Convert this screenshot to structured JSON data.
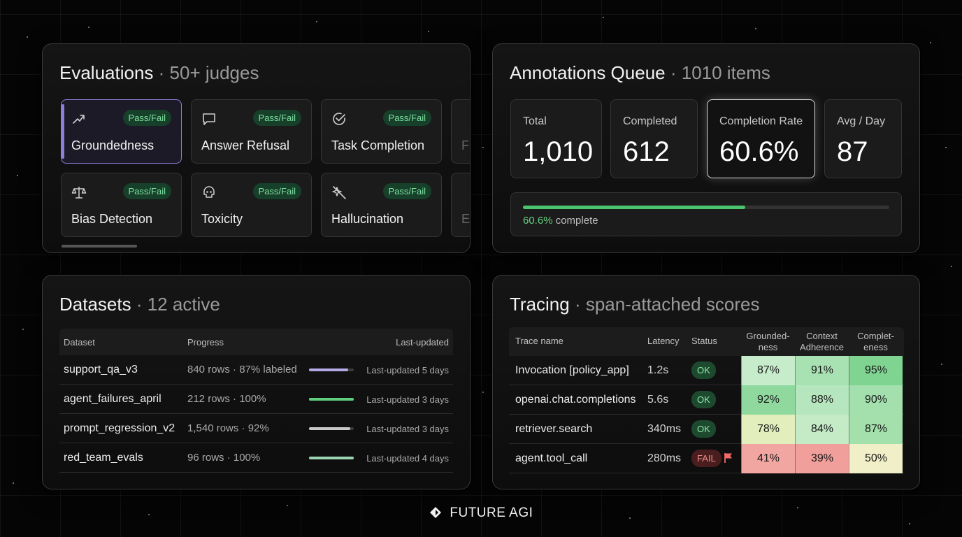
{
  "evaluations": {
    "title": "Evaluations",
    "subtitle": "· 50+ judges",
    "badge_label": "Pass/Fail",
    "judges": [
      {
        "name": "Groundedness",
        "icon": "trend-arrow-icon"
      },
      {
        "name": "Answer Refusal",
        "icon": "chat-bubble-icon"
      },
      {
        "name": "Task Completion",
        "icon": "check-circle-icon"
      },
      {
        "name": "Bias Detection",
        "icon": "scales-icon"
      },
      {
        "name": "Toxicity",
        "icon": "skull-icon"
      },
      {
        "name": "Hallucination",
        "icon": "sparkle-slash-icon"
      }
    ],
    "cut_off_letters": [
      "F",
      "E"
    ]
  },
  "annotations": {
    "title": "Annotations Queue",
    "subtitle": "· 1010 items",
    "stats": [
      {
        "label": "Total",
        "value": "1,010"
      },
      {
        "label": "Completed",
        "value": "612"
      },
      {
        "label": "Completion Rate",
        "value": "60.6%"
      },
      {
        "label": "Avg / Day",
        "value": "87"
      }
    ],
    "progress": {
      "fraction": 0.606,
      "percent_text": "60.6%",
      "suffix": "complete"
    }
  },
  "datasets": {
    "title": "Datasets",
    "subtitle": "· 12 active",
    "headers": {
      "dataset": "Dataset",
      "progress": "Progress",
      "updated": "Last-updated"
    },
    "rows": [
      {
        "name": "support_qa_v3",
        "progress": "840 rows · 87% labeled",
        "fraction": 0.87,
        "color": "#b3abe6",
        "updated": "Last-updated 5 days"
      },
      {
        "name": "agent_failures_april",
        "progress": "212 rows · 100%",
        "fraction": 1.0,
        "color": "#5fcf7f",
        "updated": "Last-updated 3 days"
      },
      {
        "name": "prompt_regression_v2",
        "progress": "1,540 rows · 92%",
        "fraction": 0.92,
        "color": "#c8c8c8",
        "updated": "Last-updated 3 days"
      },
      {
        "name": "red_team_evals",
        "progress": "96 rows · 100%",
        "fraction": 1.0,
        "color": "#9ad4b0",
        "updated": "Last-updated 4 days"
      }
    ]
  },
  "tracing": {
    "title": "Tracing",
    "subtitle": "· span-attached scores",
    "headers": {
      "trace": "Trace name",
      "latency": "Latency",
      "status": "Status",
      "groundedness_1": "Grounded-",
      "groundedness_2": "ness",
      "context_1": "Context",
      "context_2": "Adherence",
      "completeness_1": "Complet-",
      "completeness_2": "eness"
    },
    "rows": [
      {
        "name": "Invocation [policy_app]",
        "latency": "1.2s",
        "status": "OK",
        "scores": [
          "87%",
          "91%",
          "95%"
        ],
        "colors": [
          "#c6eccb",
          "#a9e2b2",
          "#7fd491"
        ]
      },
      {
        "name": "openai.chat.completions",
        "latency": "5.6s",
        "status": "OK",
        "scores": [
          "92%",
          "88%",
          "90%"
        ],
        "colors": [
          "#8fd99e",
          "#b6e6bd",
          "#a4e0ad"
        ]
      },
      {
        "name": "retriever.search",
        "latency": "340ms",
        "status": "OK",
        "scores": [
          "78%",
          "84%",
          "87%"
        ],
        "colors": [
          "#e2efbd",
          "#c4eac6",
          "#a3e0ab"
        ]
      },
      {
        "name": "agent.tool_call",
        "latency": "280ms",
        "status": "FAIL",
        "scores": [
          "41%",
          "39%",
          "50%"
        ],
        "colors": [
          "#f2a6a2",
          "#f09f9b",
          "#f1efc8"
        ]
      }
    ]
  },
  "footer": {
    "brand": "FUTURE AGI"
  },
  "colors": {
    "accent_purple": "#8d7fdc",
    "accent_green": "#4cc46d",
    "fail_red": "#f06a6a"
  }
}
